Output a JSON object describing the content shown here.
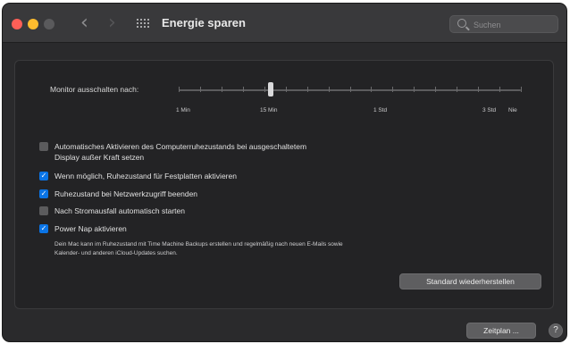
{
  "window": {
    "title": "Energie sparen"
  },
  "search": {
    "placeholder": "Suchen"
  },
  "slider": {
    "label": "Monitor ausschalten nach:",
    "tick_labels": [
      "1 Min",
      "15 Min",
      "1 Std",
      "3 Std",
      "Nie"
    ],
    "tick_count": 17
  },
  "options": [
    {
      "line1": "Automatisches Aktivieren des Computerruhezustands bei ausgeschaltetem",
      "line2": "Display außer Kraft setzen",
      "checked": false
    },
    {
      "line1": "Wenn möglich, Ruhezustand für Festplatten aktivieren",
      "checked": true
    },
    {
      "line1": "Ruhezustand bei Netzwerkzugriff beenden",
      "checked": true
    },
    {
      "line1": "Nach Stromausfall automatisch starten",
      "checked": false
    },
    {
      "line1": "Power Nap aktivieren",
      "checked": true
    }
  ],
  "power_nap_note": {
    "line1": "Dein Mac kann im Ruhezustand mit Time Machine Backups erstellen und regelmäßig nach neuen E-Mails sowie",
    "line2": "Kalender- und anderen iCloud-Updates suchen."
  },
  "buttons": {
    "restore": "Standard wiederherstellen",
    "schedule": "Zeitplan ...",
    "help": "?"
  },
  "colors": {
    "accent": "#0a74e6",
    "window_bg": "#2a2a2c",
    "titlebar_bg": "#39393b"
  }
}
